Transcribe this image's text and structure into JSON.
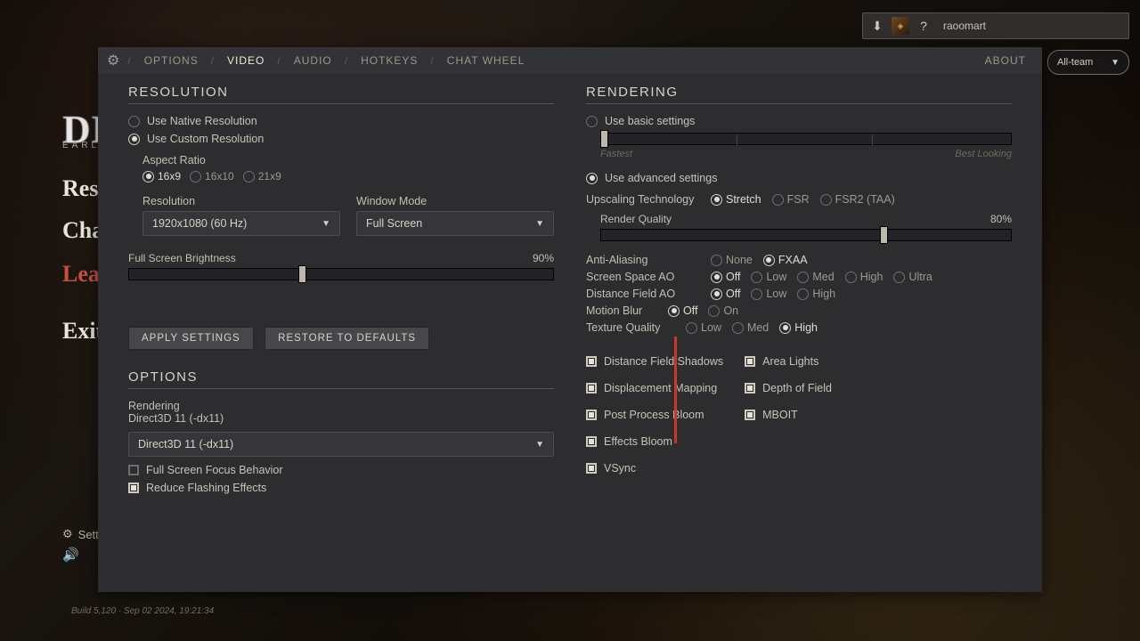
{
  "bg": {
    "title": "DE",
    "sub": "EARL",
    "links": [
      "Res",
      "Cha",
      "Leav",
      "Exit G",
      "Sett"
    ],
    "build": "Build 5,120 · Sep 02 2024, 19:21:34"
  },
  "userbar": {
    "username": "raoomart"
  },
  "teamsel": "All-team",
  "tabs": {
    "options": "OPTIONS",
    "video": "VIDEO",
    "audio": "AUDIO",
    "hotkeys": "HOTKEYS",
    "chatwheel": "CHAT WHEEL",
    "about": "ABOUT"
  },
  "left": {
    "resolution_title": "RESOLUTION",
    "use_native": "Use Native Resolution",
    "use_custom": "Use Custom Resolution",
    "aspect_label": "Aspect Ratio",
    "aspect_opts": [
      "16x9",
      "16x10",
      "21x9"
    ],
    "res_label": "Resolution",
    "res_value": "1920x1080 (60 Hz)",
    "wm_label": "Window Mode",
    "wm_value": "Full Screen",
    "bright_label": "Full Screen Brightness",
    "bright_value": "90%",
    "apply": "APPLY SETTINGS",
    "restore": "RESTORE TO DEFAULTS",
    "options_title": "OPTIONS",
    "rendering_label": "Rendering",
    "rendering_sub": "Direct3D 11 (-dx11)",
    "renderer_value": "Direct3D 11 (-dx11)",
    "focus_behavior": "Full Screen Focus Behavior",
    "reduce_flash": "Reduce Flashing Effects"
  },
  "right": {
    "rendering_title": "RENDERING",
    "use_basic": "Use basic settings",
    "basic_low": "Fastest",
    "basic_high": "Best Looking",
    "use_advanced": "Use advanced settings",
    "upscale_label": "Upscaling Technology",
    "upscale_opts": [
      "Stretch",
      "FSR",
      "FSR2 (TAA)"
    ],
    "rq_label": "Render Quality",
    "rq_value": "80%",
    "aa_label": "Anti-Aliasing",
    "aa_opts": [
      "None",
      "FXAA"
    ],
    "ssao_label": "Screen Space AO",
    "ssao_opts": [
      "Off",
      "Low",
      "Med",
      "High",
      "Ultra"
    ],
    "dfao_label": "Distance Field AO",
    "dfao_opts": [
      "Off",
      "Low",
      "High"
    ],
    "mb_label": "Motion Blur",
    "mb_opts": [
      "Off",
      "On"
    ],
    "tq_label": "Texture Quality",
    "tq_opts": [
      "Low",
      "Med",
      "High"
    ],
    "feat_left": [
      "Distance Field Shadows",
      "Displacement Mapping",
      "Post Process Bloom",
      "Effects Bloom",
      "VSync"
    ],
    "feat_right": [
      "Area Lights",
      "Depth of Field",
      "MBOIT"
    ]
  }
}
